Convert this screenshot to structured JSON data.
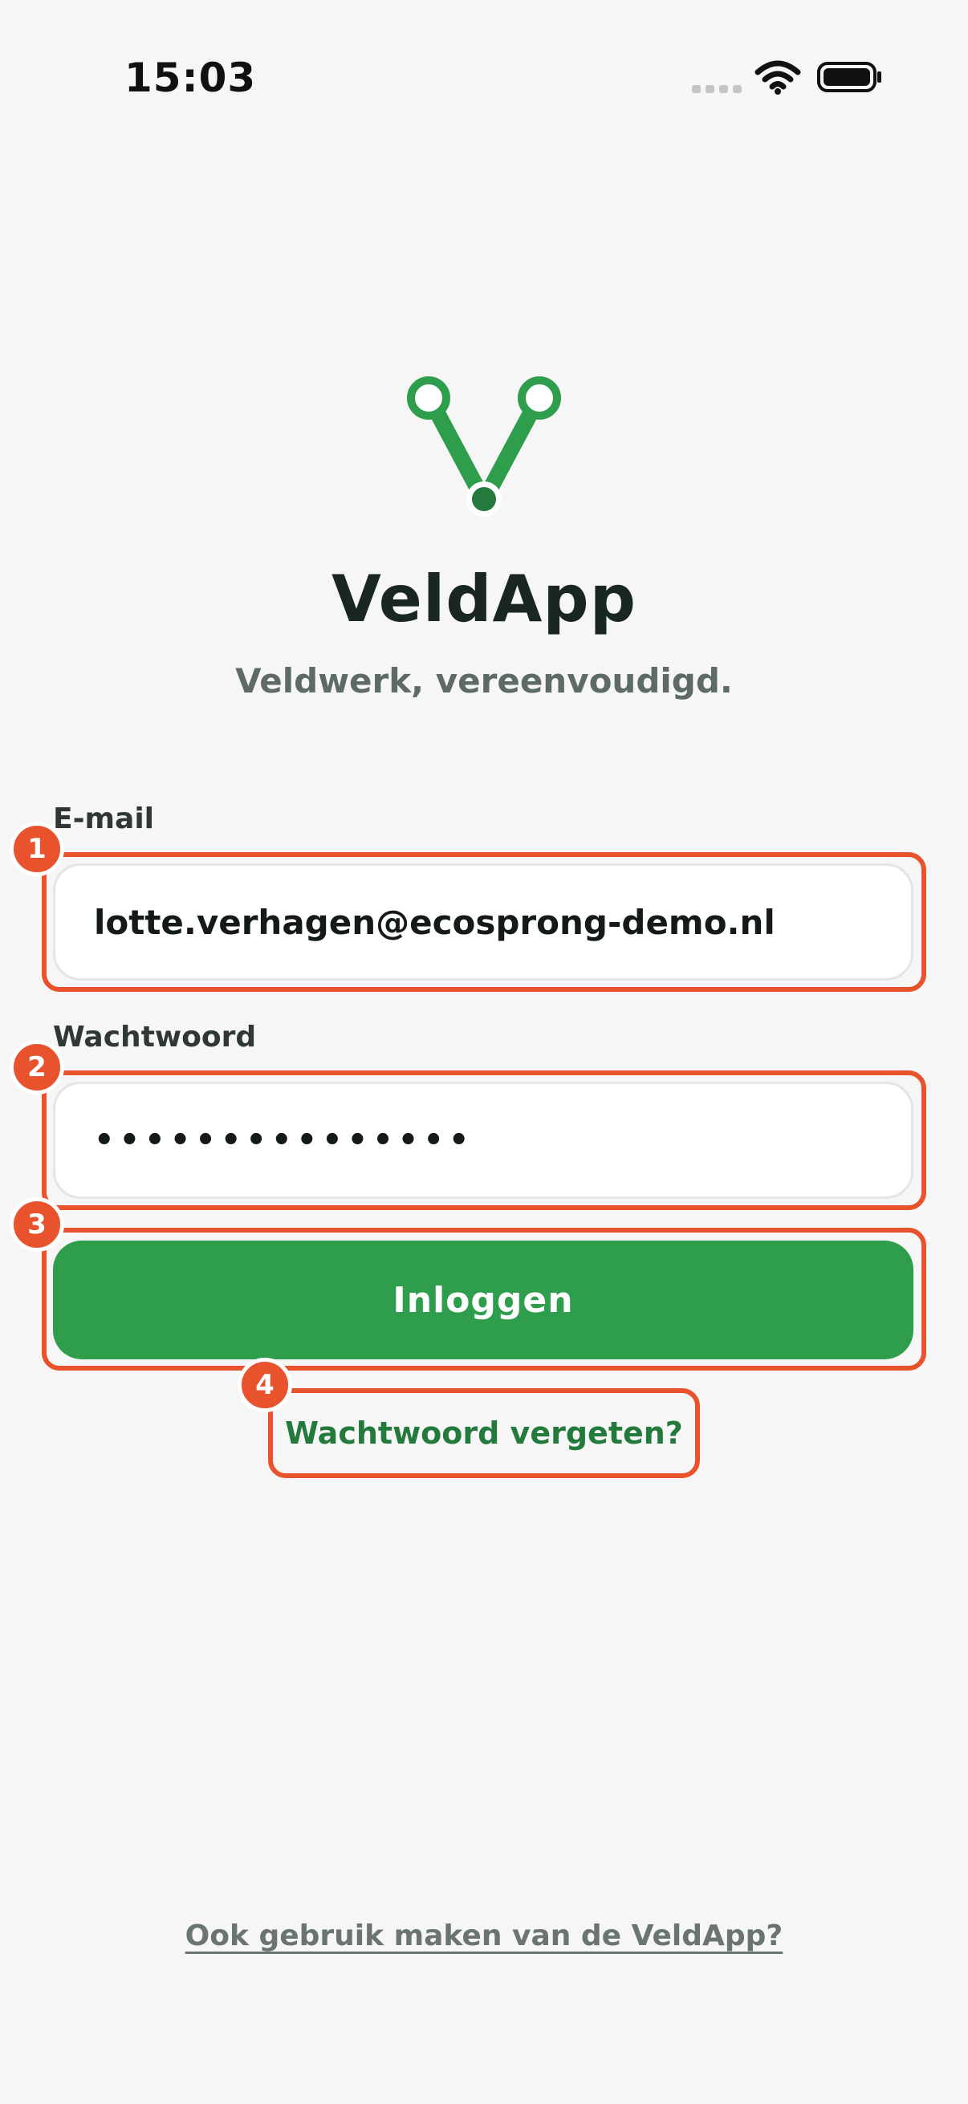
{
  "status_bar": {
    "time": "15:03"
  },
  "app": {
    "title": "VeldApp",
    "tagline": "Veldwerk, vereenvoudigd.",
    "brand_color": "#2e9e4d"
  },
  "form": {
    "email_label": "E-mail",
    "email_value": "lotte.verhagen@ecosprong-demo.nl",
    "password_label": "Wachtwoord",
    "password_masked": "•••••••••••••••",
    "login_label": "Inloggen",
    "forgot_label": "Wachtwoord vergeten?"
  },
  "footer": {
    "signup_label": "Ook gebruik maken van de VeldApp?"
  },
  "annotations": {
    "color": "#e8522d",
    "badges": [
      "1",
      "2",
      "3",
      "4"
    ]
  }
}
